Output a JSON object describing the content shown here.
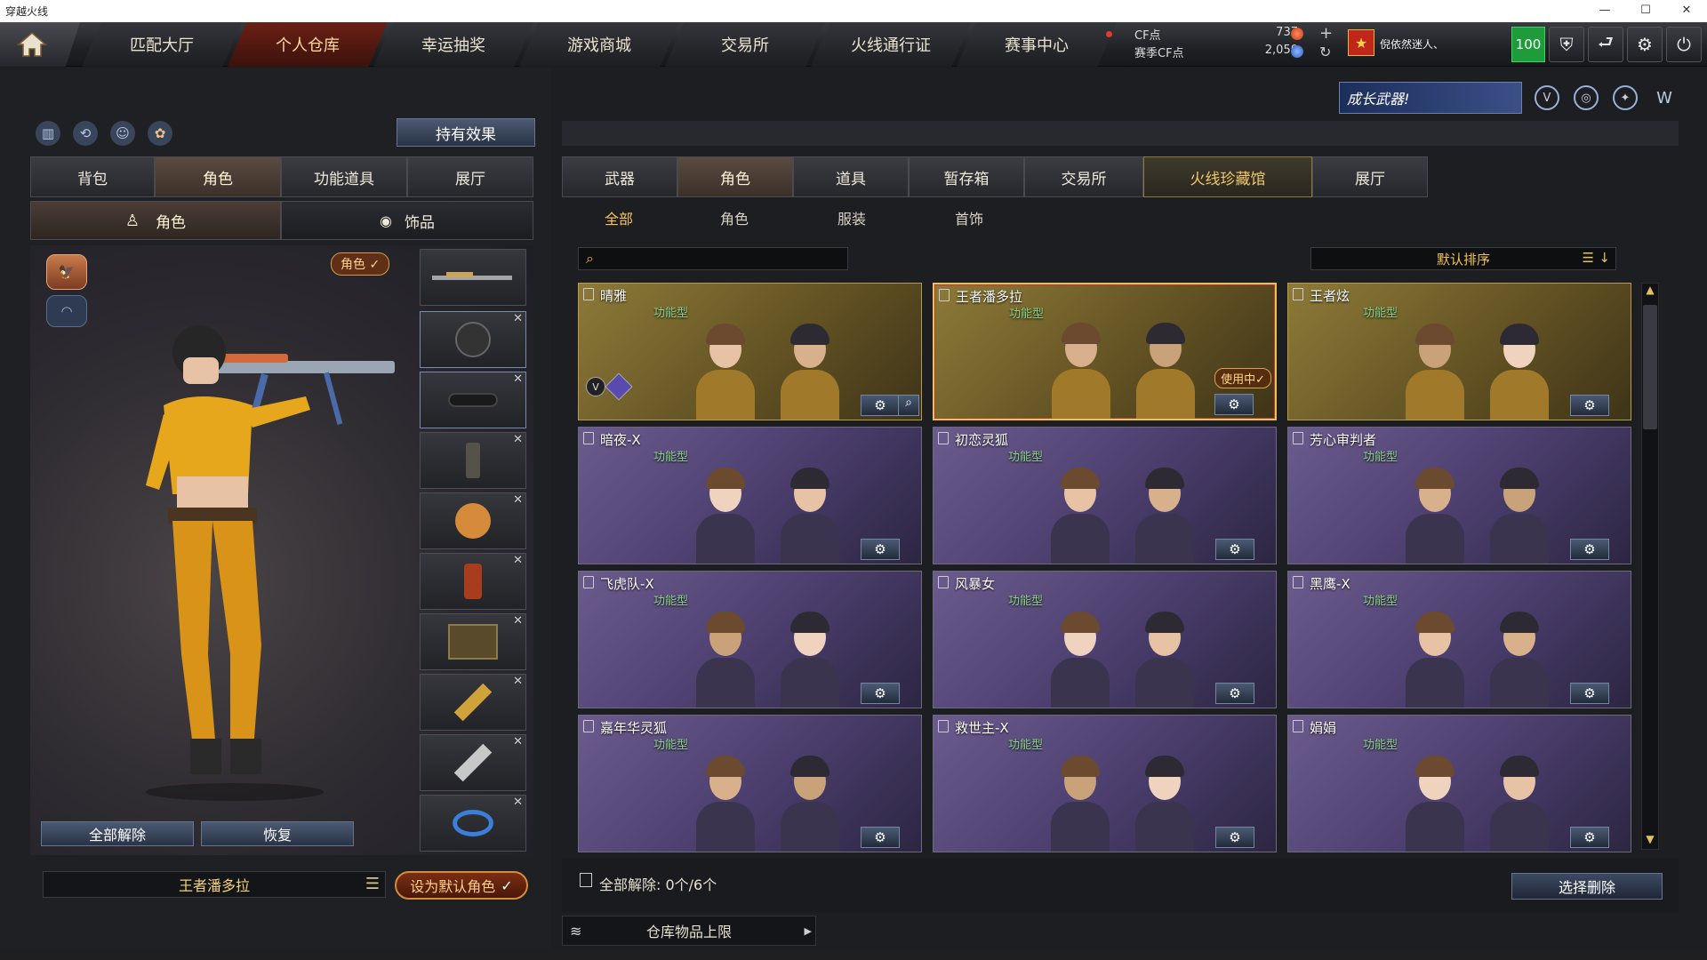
{
  "window": {
    "title": "穿越火线"
  },
  "nav": {
    "tabs": [
      "匹配大厅",
      "个人仓库",
      "幸运抽奖",
      "游戏商城",
      "交易所",
      "火线通行证",
      "赛事中心"
    ],
    "active_index": 1
  },
  "currency": {
    "cf_label": "CF点",
    "cf_value": "737",
    "season_label": "赛季CF点",
    "season_value": "2,050"
  },
  "user": {
    "name": "倪依然迷人、",
    "level_badge": "100"
  },
  "banner": {
    "text": "成长武器!"
  },
  "left": {
    "effect_button": "持有效果",
    "tabs": [
      "背包",
      "角色",
      "功能道具",
      "展厅"
    ],
    "active_tab": 1,
    "subtabs": [
      "角色",
      "饰品"
    ],
    "role_badge": "角色 ✓",
    "unequip_all": "全部解除",
    "restore": "恢复",
    "current_character": "王者潘多拉",
    "set_default": "设为默认角色"
  },
  "right": {
    "tabs": [
      "武器",
      "角色",
      "道具",
      "暂存箱",
      "交易所",
      "火线珍藏馆",
      "展厅"
    ],
    "active_tab": 1,
    "subtabs": [
      "全部",
      "角色",
      "服装",
      "首饰"
    ],
    "active_subtab": 0,
    "search": {
      "placeholder": ""
    },
    "sort_label": "默认排序",
    "cards": [
      {
        "name": "晴雅",
        "type": "功能型",
        "style": "gold"
      },
      {
        "name": "王者潘多拉",
        "type": "功能型",
        "style": "gold",
        "in_use": "使用中✓"
      },
      {
        "name": "王者炫",
        "type": "功能型",
        "style": "gold"
      },
      {
        "name": "暗夜-X",
        "type": "功能型",
        "style": "purple"
      },
      {
        "name": "初恋灵狐",
        "type": "功能型",
        "style": "purple"
      },
      {
        "name": "芳心审判者",
        "type": "功能型",
        "style": "purple"
      },
      {
        "name": "飞虎队-X",
        "type": "功能型",
        "style": "purple"
      },
      {
        "name": "风暴女",
        "type": "功能型",
        "style": "purple"
      },
      {
        "name": "黑鹰-X",
        "type": "功能型",
        "style": "purple"
      },
      {
        "name": "嘉年华灵狐",
        "type": "功能型",
        "style": "purple"
      },
      {
        "name": "救世主-X",
        "type": "功能型",
        "style": "purple"
      },
      {
        "name": "娟娟",
        "type": "功能型",
        "style": "purple"
      }
    ],
    "footer_unequip": "全部解除: 0个/6个",
    "select_delete": "选择删除",
    "storage_limit": "仓库物品上限"
  }
}
